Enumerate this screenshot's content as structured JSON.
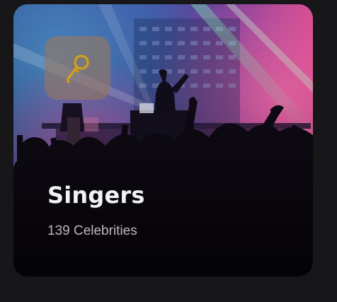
{
  "card": {
    "title": "Singers",
    "subtitle": "139 Celebrities",
    "icon": "microphone-icon",
    "background": "concert-crowd-photo"
  },
  "colors": {
    "page_background": "#17171a",
    "icon_tile": "#96785f",
    "icon_stroke": "#d3a01a",
    "title_text": "#f2f2f4",
    "subtitle_text": "#b9b6bd"
  }
}
